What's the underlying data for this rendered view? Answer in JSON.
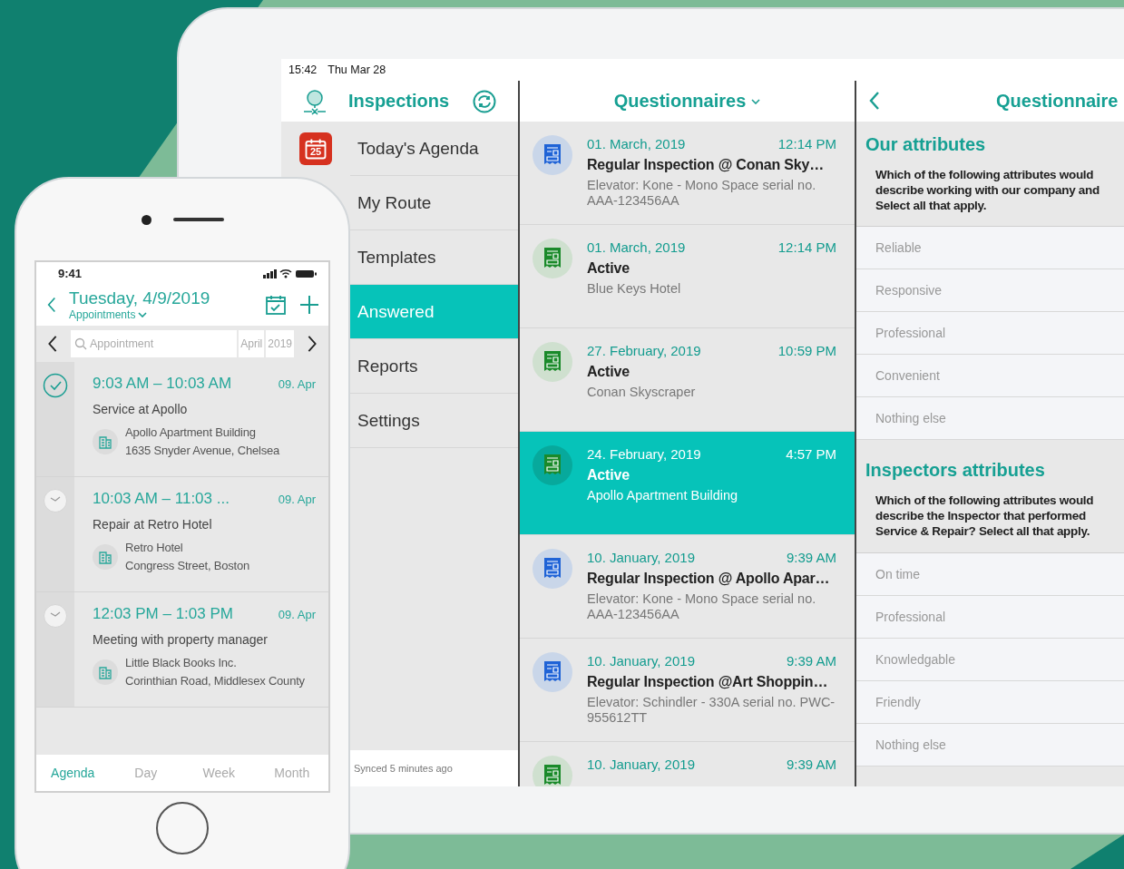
{
  "tablet": {
    "status_bar": {
      "time": "15:42",
      "date": "Thu Mar 28"
    },
    "sidebar": {
      "title": "Inspections",
      "items": [
        {
          "label": "Today's Agenda",
          "kind": "calendar",
          "badge": "25",
          "selected": false
        },
        {
          "label": "My Route",
          "kind": "plain",
          "selected": false
        },
        {
          "label": "Templates",
          "kind": "plain",
          "selected": false
        },
        {
          "label": "Answered",
          "kind": "plain",
          "selected": true
        },
        {
          "label": "Reports",
          "kind": "plain",
          "selected": false
        },
        {
          "label": "Settings",
          "kind": "plain",
          "selected": false
        }
      ],
      "footer": "Synced 5 minutes ago"
    },
    "list": {
      "title": "Questionnaires",
      "items": [
        {
          "date": "01. March, 2019",
          "time": "12:14 PM",
          "title": "Regular Inspection @ Conan Sky…",
          "subtitle": "Elevator: Kone - Mono Space serial no. AAA-123456AA",
          "color": "#1f63d6",
          "selected": false
        },
        {
          "date": "01. March, 2019",
          "time": "12:14 PM",
          "title": "Active",
          "subtitle": "Blue Keys Hotel",
          "color": "#1a8a2a",
          "selected": false
        },
        {
          "date": "27. February, 2019",
          "time": "10:59 PM",
          "title": "Active",
          "subtitle": "Conan Skyscraper",
          "color": "#1a8a2a",
          "selected": false
        },
        {
          "date": "24. February, 2019",
          "time": "4:57 PM",
          "title": "Active",
          "subtitle": "Apollo Apartment Building",
          "color": "#1a8a2a",
          "selected": true
        },
        {
          "date": "10. January, 2019",
          "time": "9:39 AM",
          "title": "Regular Inspection @ Apollo Apar…",
          "subtitle": "Elevator: Kone - Mono Space serial no. AAA-123456AA",
          "color": "#1f63d6",
          "selected": false
        },
        {
          "date": "10. January, 2019",
          "time": "9:39 AM",
          "title": "Regular Inspection @Art Shoppin…",
          "subtitle": "Elevator: Schindler - 330A serial no. PWC-955612TT",
          "color": "#1f63d6",
          "selected": false
        },
        {
          "date": "10. January, 2019",
          "time": "9:39 AM",
          "color": "#1a8a2a",
          "selected": false
        }
      ]
    },
    "detail": {
      "title": "Questionnaire",
      "sections": [
        {
          "heading": "Our attributes",
          "question": [
            "Which of the following attributes would",
            "describe working with our company and",
            "Select all that apply."
          ],
          "options": [
            "Reliable",
            "Responsive",
            "Professional",
            "Convenient",
            "Nothing else"
          ]
        },
        {
          "heading": "Inspectors attributes",
          "question": [
            "Which of the following attributes would",
            "describe the Inspector that performed",
            "Service & Repair? Select all that apply."
          ],
          "options": [
            "On time",
            "Professional",
            "Knowledgable",
            "Friendly",
            "Nothing else"
          ]
        }
      ]
    }
  },
  "phone": {
    "status_bar": {
      "time": "9:41"
    },
    "header": {
      "title": "Tuesday, 4/9/2019",
      "subtitle": "Appointments"
    },
    "search": {
      "placeholder": "Appointment",
      "month": "April",
      "year": "2019"
    },
    "appointments": [
      {
        "time": "9:03 AM – 10:03 AM",
        "date": "09. Apr",
        "title": "Service at Apollo",
        "place": "Apollo Apartment Building",
        "address": "1635 Snyder Avenue, Chelsea",
        "done": true
      },
      {
        "time": "10:03 AM – 11:03 ...",
        "date": "09. Apr",
        "title": "Repair at Retro Hotel",
        "place": "Retro Hotel",
        "address": "Congress Street, Boston",
        "done": false
      },
      {
        "time": "12:03 PM – 1:03 PM",
        "date": "09. Apr",
        "title": "Meeting with property manager",
        "place": "Little Black Books Inc.",
        "address": "Corinthian Road, Middlesex County",
        "done": false
      }
    ],
    "tabs": [
      {
        "label": "Agenda",
        "selected": true
      },
      {
        "label": "Day",
        "selected": false
      },
      {
        "label": "Week",
        "selected": false
      },
      {
        "label": "Month",
        "selected": false
      }
    ]
  }
}
